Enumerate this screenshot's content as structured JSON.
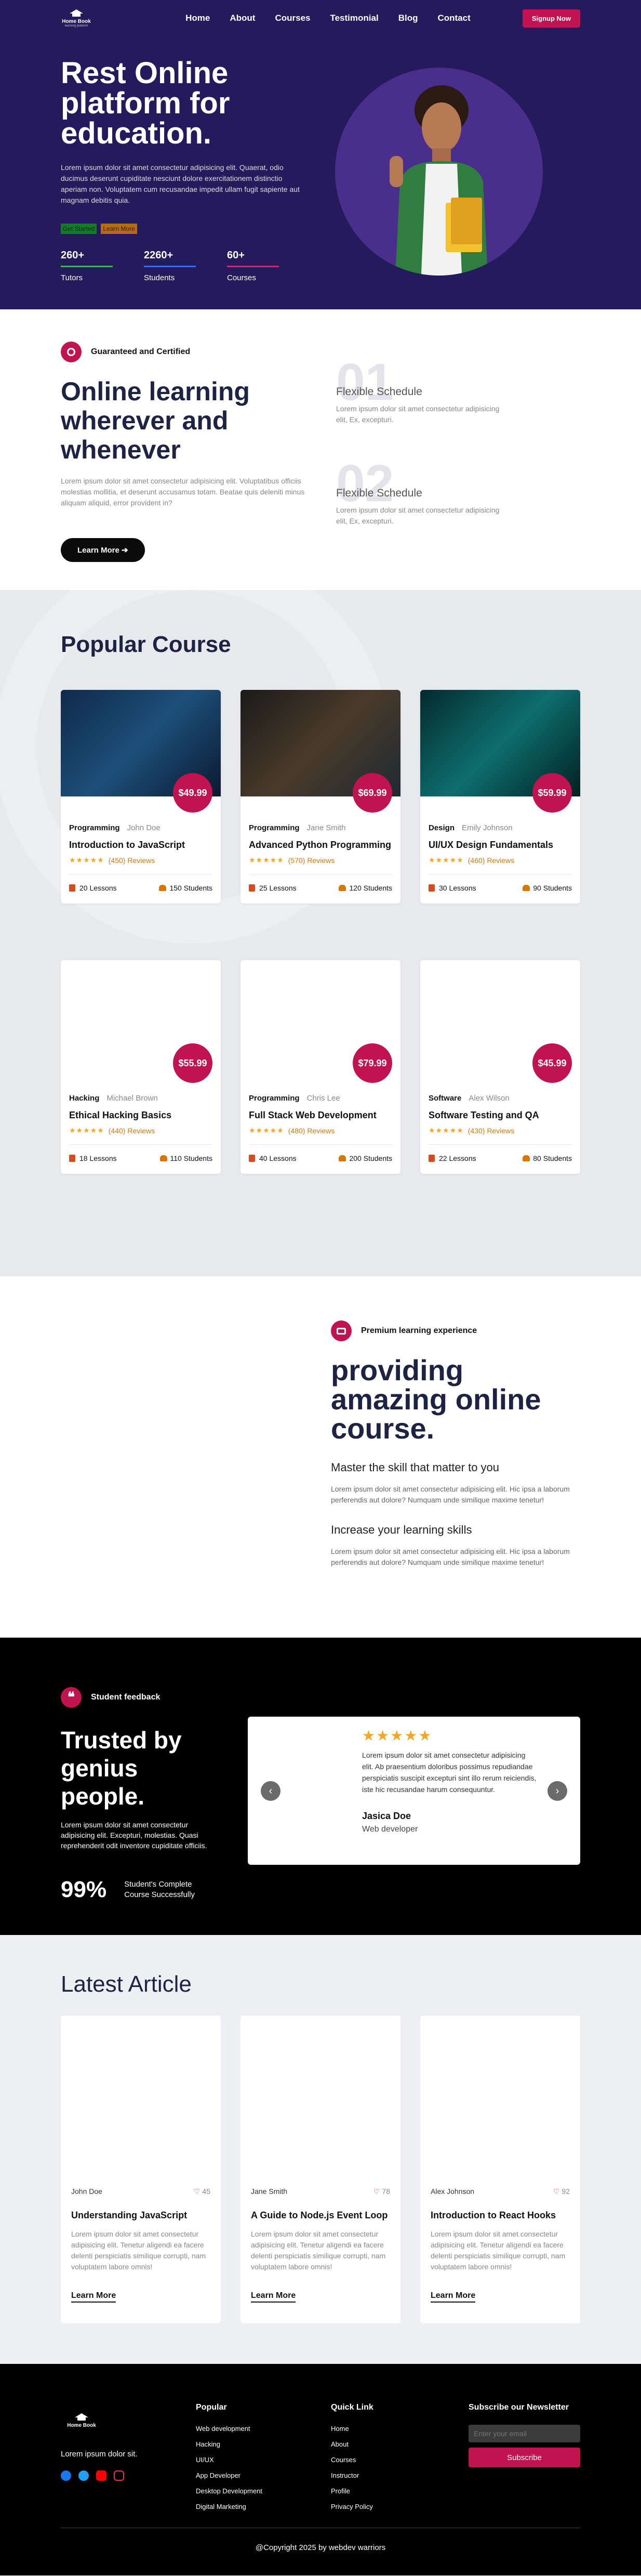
{
  "nav": {
    "logo_text": "Home Book",
    "logo_sub": "learning platform",
    "links": [
      "Home",
      "About",
      "Courses",
      "Testimonial",
      "Blog",
      "Contact"
    ],
    "signup": "Signup Now"
  },
  "hero": {
    "title": "Rest Online platform for education.",
    "description": "Lorem ipsum dolor sit amet consectetur adipisicing elit. Quaerat, odio ducimus deserunt cupiditate nesciunt dolore exercitationem distinctio aperiam non. Voluptatem cum recusandae impedit ullam fugit sapiente aut magnam debitis quia.",
    "tags": [
      "Get Started",
      "Learn More"
    ],
    "stats": [
      {
        "num": "260+",
        "label": "Tutors",
        "color": "#2fbf45"
      },
      {
        "num": "2260+",
        "label": "Students",
        "color": "#2f6bff"
      },
      {
        "num": "60+",
        "label": "Courses",
        "color": "#e11d74"
      }
    ]
  },
  "features": {
    "badge": "Guaranteed and Certified",
    "title": "Online learning wherever and whenever",
    "description": "Lorem ipsum dolor sit amet consectetur adipisicing elit. Voluptatibus officiis molestias mollitia, et deserunt accusamus totam. Beatae quis deleniti minus aliquam aliquid, error provident in?",
    "button": "Learn More",
    "steps": [
      {
        "num": "01",
        "title": "Flexible Schedule",
        "desc": "Lorem ipsum dolor sit amet consectetur adipisicing elit, Ex, excepturi."
      },
      {
        "num": "02",
        "title": "Flexible Schedule",
        "desc": "Lorem ipsum dolor sit amet consectetur adipisicing elit, Ex, excepturi."
      }
    ]
  },
  "popular": {
    "title": "Popular Course",
    "courses": [
      {
        "category": "Programming",
        "author": "John Doe",
        "title": "Introduction to JavaScript",
        "price": "$49.99",
        "reviews": "(450) Reviews",
        "lessons": "20 Lessons",
        "students": "150 Students"
      },
      {
        "category": "Programming",
        "author": "Jane Smith",
        "title": "Advanced Python Programming",
        "price": "$69.99",
        "reviews": "(570) Reviews",
        "lessons": "25 Lessons",
        "students": "120 Students"
      },
      {
        "category": "Design",
        "author": "Emily Johnson",
        "title": "UI/UX Design Fundamentals",
        "price": "$59.99",
        "reviews": "(460) Reviews",
        "lessons": "30 Lessons",
        "students": "90 Students"
      },
      {
        "category": "Hacking",
        "author": "Michael Brown",
        "title": "Ethical Hacking Basics",
        "price": "$55.99",
        "reviews": "(440) Reviews",
        "lessons": "18 Lessons",
        "students": "110 Students"
      },
      {
        "category": "Programming",
        "author": "Chris Lee",
        "title": "Full Stack Web Development",
        "price": "$79.99",
        "reviews": "(480) Reviews",
        "lessons": "40 Lessons",
        "students": "200 Students"
      },
      {
        "category": "Software",
        "author": "Alex Wilson",
        "title": "Software Testing and QA",
        "price": "$45.99",
        "reviews": "(430) Reviews",
        "lessons": "22 Lessons",
        "students": "80 Students"
      }
    ]
  },
  "experience": {
    "badge": "Premium learning experience",
    "title": "providing amazing online course.",
    "items": [
      {
        "title": "Master the skill that matter to you",
        "desc": "Lorem ipsum dolor sit amet consectetur adipisicing elit. Hic ipsa a laborum perferendis aut dolore? Numquam unde similique maxime tenetur!"
      },
      {
        "title": "Increase your learning skills",
        "desc": "Lorem ipsum dolor sit amet consectetur adipisicing elit. Hic ipsa a laborum perferendis aut dolore? Numquam unde similique maxime tenetur!"
      }
    ]
  },
  "testimonial": {
    "badge": "Student feedback",
    "title": "Trusted by genius people.",
    "description": "Lorem ipsum dolor sit amet consectetur adipisicing elit. Excepturi, molestias. Quasi reprehenderit odit inventore cupiditate officiis.",
    "stat_num": "99%",
    "stat_label": "Student's Complete Course Successfully",
    "stars": "★★★★★",
    "quote": "Lorem ipsum dolor sit amet consectetur adipisicing elit. Ab praesentium doloribus possimus repudiandae perspiciatis suscipit excepturi sint illo rerum reiciendis, iste hic recusandae harum consequuntur.",
    "name": "Jasica Doe",
    "role": "Web developer",
    "prev": "‹",
    "next": "›"
  },
  "articles": {
    "title": "Latest Article",
    "items": [
      {
        "author": "John Doe",
        "likes": "45",
        "title": "Understanding JavaScript",
        "desc": "Lorem ipsum dolor sit amet consectetur adipisicing elit. Tenetur aligendi ea facere delenti perspiciatis similique corrupti, nam voluptatem labore omnis!",
        "link": "Learn More"
      },
      {
        "author": "Jane Smith",
        "likes": "78",
        "title": "A Guide to Node.js Event Loop",
        "desc": "Lorem ipsum dolor sit amet consectetur adipisicing elit. Tenetur aligendi ea facere delenti perspiciatis similique corrupti, nam voluptatem labore omnis!",
        "link": "Learn More"
      },
      {
        "author": "Alex Johnson",
        "likes": "92",
        "title": "Introduction to React Hooks",
        "desc": "Lorem ipsum dolor sit amet consectetur adipisicing elit. Tenetur aligendi ea facere delenti perspiciatis similique corrupti, nam voluptatem labore omnis!",
        "link": "Learn More"
      }
    ]
  },
  "footer": {
    "logo_text": "Home Book",
    "tagline": "Lorem ipsum dolor sit.",
    "social": [
      {
        "name": "facebook-icon",
        "color": "#1877f2"
      },
      {
        "name": "twitter-icon",
        "color": "#1da1f2"
      },
      {
        "name": "youtube-icon",
        "color": "#ff0000"
      },
      {
        "name": "instagram-icon",
        "color": "#e1306c"
      }
    ],
    "popular_title": "Popular",
    "popular_links": [
      "Web development",
      "Hacking",
      "UI/UX",
      "App Developer",
      "Desktop Development",
      "Digital Marketing"
    ],
    "quick_title": "Quick Link",
    "quick_links": [
      "Home",
      "About",
      "Courses",
      "Instructor",
      "Profile",
      "Privacy Policy"
    ],
    "newsletter_title": "Subscribe our Newsletter",
    "email_placeholder": "Enter your email",
    "subscribe": "Subscribe",
    "copyright": "@Copyright 2025 by webdev warriors"
  }
}
